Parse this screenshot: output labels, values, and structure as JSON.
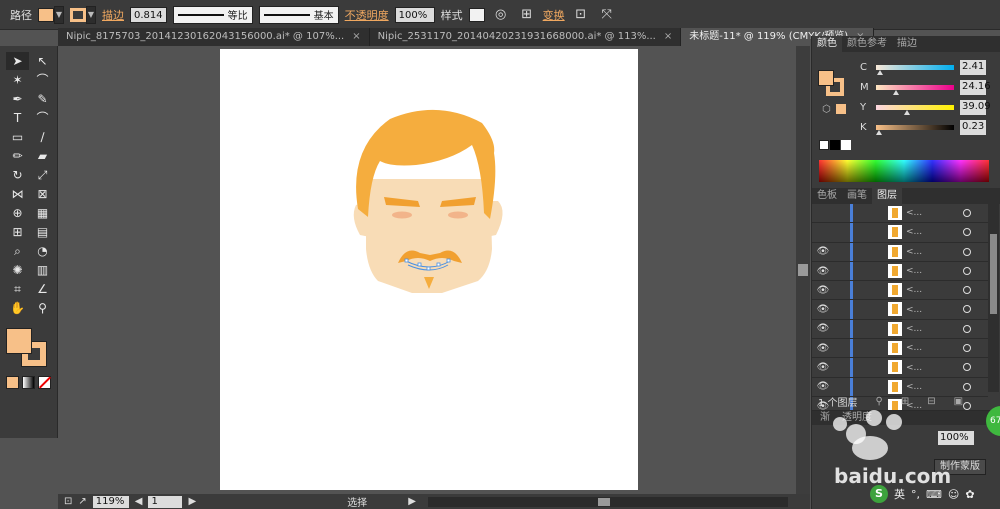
{
  "control_bar": {
    "object_type": "路径",
    "stroke_label": "描边",
    "stroke_weight": "0.814",
    "stroke_profile": "等比",
    "brush": "基本",
    "opacity_label": "不透明度",
    "opacity_value": "100%",
    "style_label": "样式",
    "transform_label": "变换",
    "fill_color": "#f7c088"
  },
  "tabs": [
    {
      "label": "Nipic_8175703_20141230162043156000.ai* @ 107%...",
      "close": "×"
    },
    {
      "label": "Nipic_2531170_20140420231931668000.ai* @ 113%...",
      "close": "×"
    },
    {
      "label": "未标题-11* @ 119% (CMYK/预览)",
      "close": "×"
    }
  ],
  "status": {
    "zoom": "119%",
    "page": "1",
    "mode": "选择"
  },
  "color_panel": {
    "tabs": [
      "颜色",
      "颜色参考",
      "描边"
    ],
    "channels": [
      {
        "name": "C",
        "value": "2.41",
        "percent": 2.41
      },
      {
        "name": "M",
        "value": "24.16",
        "percent": 24.16
      },
      {
        "name": "Y",
        "value": "39.09",
        "percent": 39.09
      },
      {
        "name": "K",
        "value": "0.23",
        "percent": 0.23
      }
    ]
  },
  "layers_panel": {
    "tabs": [
      "色板",
      "画笔",
      "图层"
    ],
    "rows": [
      "<...",
      "<...",
      "<...",
      "<...",
      "<...",
      "<...",
      "<...",
      "<...",
      "<...",
      "<...",
      "<..."
    ],
    "footer": "1 个图层"
  },
  "bottom_panel": {
    "tabs": [
      "渐",
      "透明度"
    ],
    "opacity_value": "100%",
    "mask_button": "制作蒙版",
    "ime_badge": "S",
    "ime_lang": "英"
  },
  "watermark": "baidu.com",
  "green_badge": "67"
}
